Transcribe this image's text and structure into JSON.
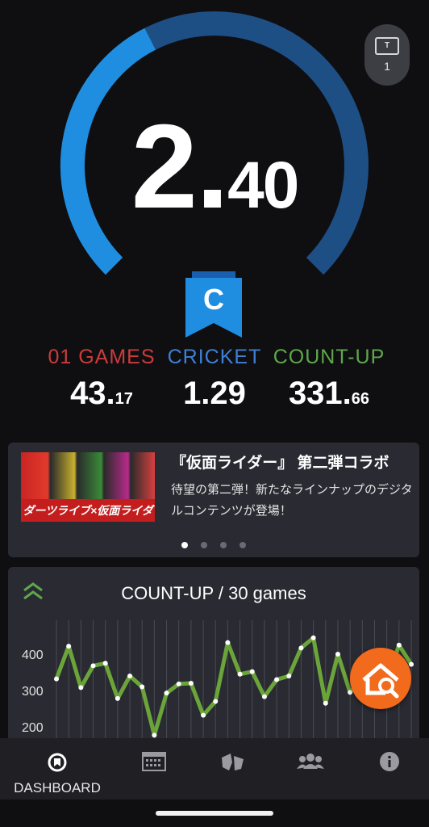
{
  "ticket": {
    "icon": "ticket-icon",
    "count": "1"
  },
  "rating": {
    "integer": "2",
    "dot": ".",
    "decimal": "40",
    "gauge_fraction": 0.4,
    "class_letter": "C"
  },
  "stats": [
    {
      "label": "01 GAMES",
      "value_main": "43.",
      "value_small": "17",
      "color": "#cc3b3b"
    },
    {
      "label": "CRICKET",
      "value_main": "1.29",
      "value_small": "",
      "color": "#3f7fd6"
    },
    {
      "label": "COUNT-UP",
      "value_main": "331.",
      "value_small": "66",
      "color": "#5da84a"
    }
  ],
  "banner": {
    "image_text": "ダーツライブ×仮面ライダー",
    "title": "『仮面ライダー』 第二弾コラボ",
    "description": "待望の第二弾！新たなラインナップのデジタルコンテンツが登場！",
    "page_count": 4,
    "active_page": 0
  },
  "chart": {
    "title": "COUNT-UP / 30 games",
    "fab_icon": "home-search-icon"
  },
  "chart_data": {
    "type": "line",
    "title": "COUNT-UP / 30 games",
    "xlabel": "",
    "ylabel": "",
    "yticks": [
      200,
      300,
      400
    ],
    "ylim": [
      150,
      480
    ],
    "values": [
      332,
      422,
      308,
      368,
      375,
      278,
      340,
      310,
      177,
      293,
      318,
      320,
      232,
      270,
      432,
      345,
      352,
      283,
      330,
      340,
      417,
      445,
      265,
      400,
      295,
      335,
      295,
      330,
      425,
      372
    ],
    "color": "#6ba53a"
  },
  "nav": [
    {
      "id": "dashboard",
      "label": "DASHBOARD",
      "icon": "dashboard-icon"
    },
    {
      "id": "calendar",
      "label": "",
      "icon": "calendar-icon"
    },
    {
      "id": "darts",
      "label": "",
      "icon": "darts-icon"
    },
    {
      "id": "friends",
      "label": "",
      "icon": "friends-icon"
    },
    {
      "id": "info",
      "label": "",
      "icon": "info-icon"
    }
  ]
}
